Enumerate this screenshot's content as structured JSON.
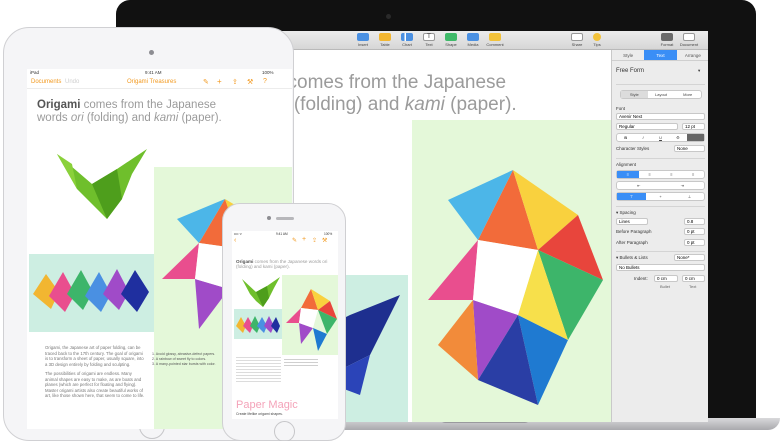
{
  "mac": {
    "toolbar": {
      "left_items": [
        {
          "label": "Insert",
          "color": "#4a90e2"
        },
        {
          "label": "Table",
          "color": "#f2b631"
        },
        {
          "label": "Chart",
          "color": "#4a90e2"
        },
        {
          "label": "Text",
          "color": "#7d7d7d"
        },
        {
          "label": "Shape",
          "color": "#3fba69"
        },
        {
          "label": "Media",
          "color": "#4a90e2"
        },
        {
          "label": "Comment",
          "color": "#f2c23a"
        }
      ],
      "right_items": [
        {
          "label": "Share"
        },
        {
          "label": "Tips"
        }
      ],
      "far_right_items": [
        {
          "label": "Format"
        },
        {
          "label": "Document"
        }
      ]
    },
    "document": {
      "heading_line1": "i comes from the Japanese",
      "heading_line2_pre": "ri",
      "heading_line2_mid": " (folding) and ",
      "heading_line2_kami": "kami",
      "heading_line2_post": " (paper)."
    },
    "inspector": {
      "tabs": [
        "Style",
        "Text",
        "Arrange"
      ],
      "paragraph_style": "Free Form",
      "subtabs": [
        "Style",
        "Layout",
        "More"
      ],
      "font_label": "Font",
      "font_name": "Avenir Next",
      "font_weight": "Regular",
      "font_size": "12 pt",
      "character_styles_label": "Character Styles",
      "character_styles_value": "None",
      "alignment_label": "Alignment",
      "spacing_label": "Spacing",
      "spacing_mode": "Lines",
      "spacing_value": "0.8",
      "before_paragraph_label": "Before Paragraph",
      "before_paragraph_value": "0 pt",
      "after_paragraph_label": "After Paragraph",
      "after_paragraph_value": "0 pt",
      "bullets_label": "Bullets & Lists",
      "bullets_value": "None*",
      "bullets_type": "No Bullets",
      "indent_label": "Indent:",
      "indent_bullet_value": "0 cm",
      "indent_text_value": "0 cm",
      "indent_bullet_caption": "Bullet",
      "indent_text_caption": "Text"
    }
  },
  "ipad": {
    "status": {
      "left": "iPad",
      "time": "9:41 AM",
      "battery": "100%"
    },
    "nav": {
      "documents": "Documents",
      "undo": "Undo",
      "title": "Origami Treasures"
    },
    "heading_bold": "Origami",
    "heading_rest1": " comes from the Japanese",
    "heading_line2_pre": "words ",
    "heading_ori": "ori",
    "heading_mid": " (folding) and ",
    "heading_kami": "kami",
    "heading_post": " (paper).",
    "body_p1": "Origami, the Japanese art of paper folding, can be traced back to the 17th century. The goal of origami is to transform a sheet of paper, usually square, into a 3D design entirely by folding and sculpting.",
    "body_p2": "The possibilities of origami are endless. Many animal shapes are easy to make, as are boats and planes (which are perfect for floating and flying). Master origami artists also create beautiful works of art, like those shown here, that seem to come to life.",
    "list": [
      "1.  Avoid glossy, abrasive-defect papers.",
      "2.  A rainbow of sweet fly to colors.",
      "3.  A many-pointed star bursts with color."
    ]
  },
  "iphone": {
    "status": {
      "left": "•••• ᯤ",
      "time": "9:41 AM",
      "battery": "100%"
    },
    "heading_bold": "Origami",
    "heading_rest": " comes from the Japanese words ori (folding) and kami (paper).",
    "magic_title": "Paper Magic",
    "magic_subtitle": "Create lifelike origami shapes."
  }
}
